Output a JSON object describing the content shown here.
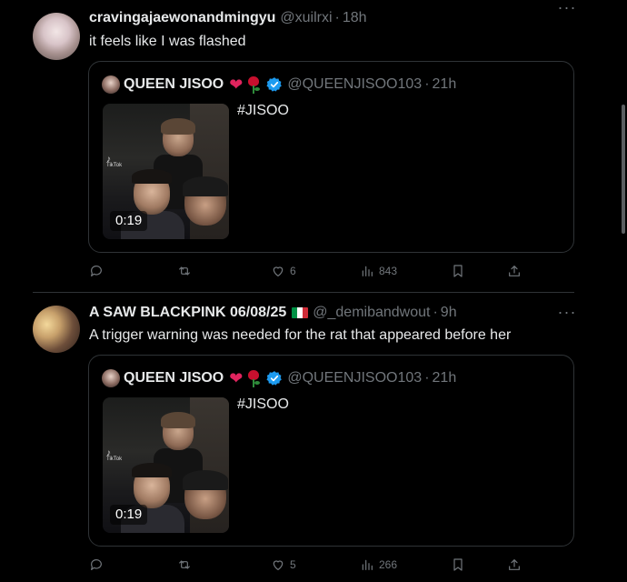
{
  "tweets": [
    {
      "author_name": "cravingajaewonandmingyu",
      "handle": "@xuilrxi",
      "time": "18h",
      "text": "it feels like I was flashed",
      "quote": {
        "author_name": "QUEEN JISOO",
        "handle": "@QUEENJISOO103",
        "time": "21h",
        "text": "#JISOO",
        "video_duration": "0:19",
        "video_watermark": "TikTok"
      },
      "likes": "6",
      "views": "843"
    },
    {
      "author_name": "A SAW BLACKPINK 06/08/25",
      "handle": "@_demibandwout",
      "time": "9h",
      "text": "A trigger warning was needed for the rat that appeared before her",
      "quote": {
        "author_name": "QUEEN JISOO",
        "handle": "@QUEENJISOO103",
        "time": "21h",
        "text": "#JISOO",
        "video_duration": "0:19",
        "video_watermark": "TikTok"
      },
      "likes": "5",
      "views": "266"
    }
  ],
  "separator": "·",
  "colors": {
    "background": "#000000",
    "text_primary": "#e7e9ea",
    "text_secondary": "#71767b",
    "border": "#2f3336",
    "verified_blue": "#1d9bf0",
    "heart_red": "#e0245e"
  },
  "icons": [
    "more-icon",
    "verified-badge-icon",
    "heart-emoji-icon",
    "rose-emoji-icon",
    "italy-flag-icon",
    "reply-icon",
    "retweet-icon",
    "like-icon",
    "views-icon",
    "bookmark-icon",
    "share-icon"
  ]
}
